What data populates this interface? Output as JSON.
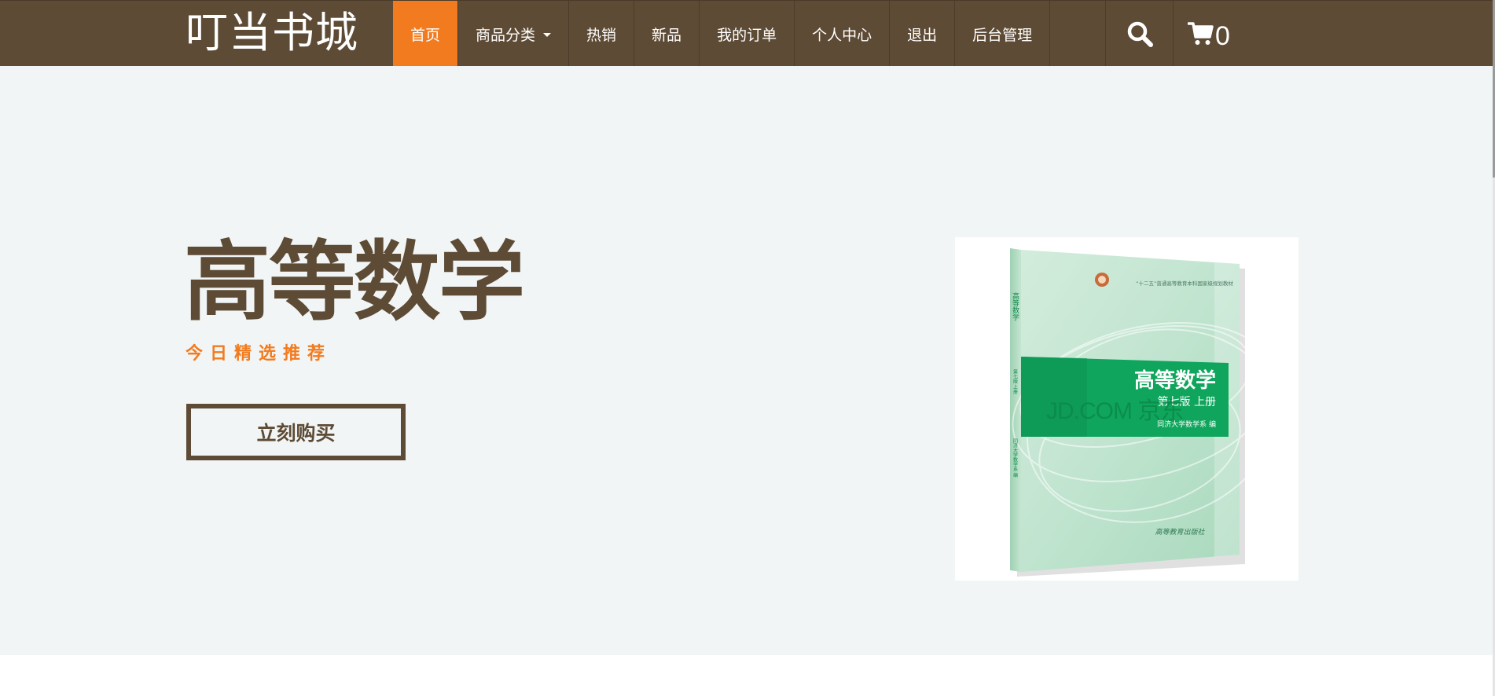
{
  "brand": "叮当书城",
  "nav": {
    "items": [
      {
        "label": "首页",
        "active": true
      },
      {
        "label": "商品分类",
        "dropdown": true
      },
      {
        "label": "热销"
      },
      {
        "label": "新品"
      },
      {
        "label": "我的订单"
      },
      {
        "label": "个人中心"
      },
      {
        "label": "退出"
      },
      {
        "label": "后台管理"
      }
    ],
    "cart_count": "0",
    "search_icon": "search-icon",
    "cart_icon": "cart-icon"
  },
  "hero": {
    "title": "高等数学",
    "subtitle": "今日精选推荐",
    "button_label": "立刻购买",
    "book": {
      "top_line": "“十二五”普通高等教育本科国家级规划教材",
      "spine_title": "高等数学",
      "spine_edition": "第七版 上册",
      "spine_author": "同济大学数学系 编",
      "cover_title": "高等数学",
      "cover_edition": "第七版 上册",
      "cover_author": "同济大学数学系 编",
      "watermark": "JD.COM 京东",
      "publisher": "高等教育出版社"
    }
  },
  "colors": {
    "nav_bg": "#5e4b35",
    "accent": "#f27b1f",
    "hero_bg": "#f1f5f6",
    "book_green": "#0fa55c"
  }
}
